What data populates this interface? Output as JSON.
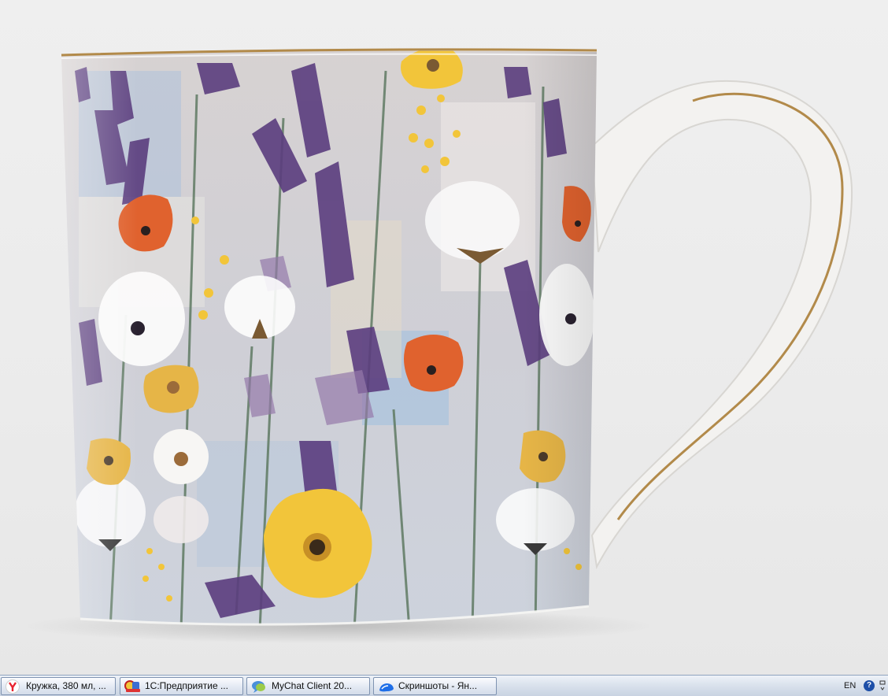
{
  "photo": {
    "subject": "floral porcelain mug with gold rim"
  },
  "taskbar": {
    "items": [
      {
        "label": "Кружка, 380 мл, ...",
        "icon": "yandex-browser-icon"
      },
      {
        "label": "1С:Предприятие ...",
        "icon": "1c-enterprise-icon"
      },
      {
        "label": "MyChat Client 20...",
        "icon": "mychat-icon"
      },
      {
        "label": "Скриншоты - Ян...",
        "icon": "yandex-disk-icon"
      }
    ],
    "tray": {
      "language": "EN",
      "help_glyph": "?"
    }
  },
  "colors": {
    "lavender": "#5b3d7e",
    "poppy": "#e0622e",
    "yellow": "#f2c53a",
    "gold": "#b28a4a",
    "porcelain": "#f4f3f1"
  }
}
